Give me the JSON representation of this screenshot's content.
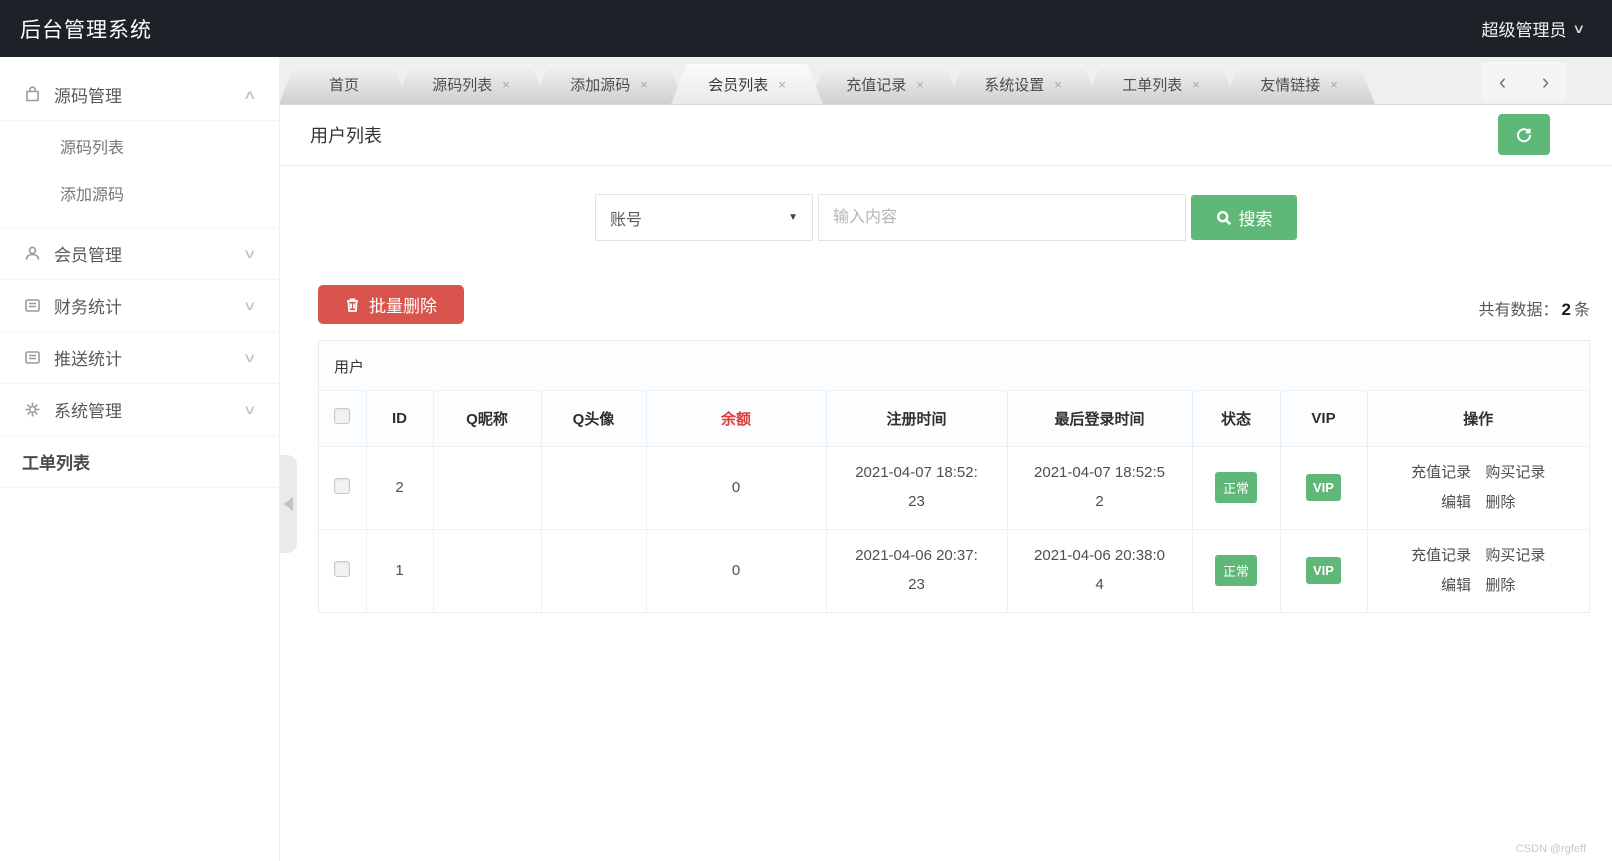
{
  "colors": {
    "green": "#5FB878",
    "red": "#D9544C",
    "balred": "#E03C3C",
    "hdr": "#1F2128"
  },
  "icons": {
    "chevron_down": "∨",
    "chevron_up": "∧",
    "arrow_left": "‹",
    "arrow_right": "›",
    "close": "×",
    "dropdown_caret": "▼",
    "named": [
      "bag-icon",
      "user-icon",
      "finance-icon",
      "push-icon",
      "gear-icon",
      "search-icon",
      "refresh-icon",
      "trash-icon",
      "collapse-left-icon",
      "chevron-down-icon"
    ]
  },
  "header": {
    "title": "后台管理系统",
    "user": "超级管理员"
  },
  "sidebar": {
    "items": [
      {
        "label": "源码管理",
        "icon": "bag-icon",
        "state": "expanded",
        "children": [
          "源码列表",
          "添加源码"
        ]
      },
      {
        "label": "会员管理",
        "icon": "user-icon",
        "state": "collapsed"
      },
      {
        "label": "财务统计",
        "icon": "finance-icon",
        "state": "collapsed"
      },
      {
        "label": "推送统计",
        "icon": "push-icon",
        "state": "collapsed"
      },
      {
        "label": "系统管理",
        "icon": "gear-icon",
        "state": "collapsed"
      },
      {
        "label": "工单列表"
      }
    ]
  },
  "tabs": {
    "active": "会员列表",
    "items": [
      {
        "label": "首页",
        "closable": false
      },
      {
        "label": "源码列表",
        "closable": true
      },
      {
        "label": "添加源码",
        "closable": true
      },
      {
        "label": "会员列表",
        "closable": true
      },
      {
        "label": "充值记录",
        "closable": true
      },
      {
        "label": "系统设置",
        "closable": true
      },
      {
        "label": "工单列表",
        "closable": true
      },
      {
        "label": "友情链接",
        "closable": true
      }
    ]
  },
  "page": {
    "title": "用户列表"
  },
  "search": {
    "field_selected": "账号",
    "input_placeholder": "输入内容",
    "button_label": "搜索"
  },
  "toolbar": {
    "batch_delete_label": "批量删除",
    "count_prefix": "共有数据：",
    "count": "2",
    "count_suffix": "条"
  },
  "table": {
    "caption": "用户",
    "headers": [
      "ID",
      "Q昵称",
      "Q头像",
      "余额",
      "注册时间",
      "最后登录时间",
      "状态",
      "VIP",
      "操作"
    ],
    "rows": [
      {
        "id": "2",
        "q_nickname": "",
        "q_avatar": "",
        "balance": "0",
        "register_time": "2021-04-07 18:52:23",
        "last_login": "2021-04-07 18:52:52",
        "status": "正常",
        "vip": "VIP",
        "actions": [
          "充值记录",
          "购买记录",
          "编辑",
          "删除"
        ]
      },
      {
        "id": "1",
        "q_nickname": "",
        "q_avatar": "",
        "balance": "0",
        "register_time": "2021-04-06 20:37:23",
        "last_login": "2021-04-06 20:38:04",
        "status": "正常",
        "vip": "VIP",
        "actions": [
          "充值记录",
          "购买记录",
          "编辑",
          "删除"
        ]
      }
    ]
  },
  "watermark": "CSDN @rgfeff"
}
